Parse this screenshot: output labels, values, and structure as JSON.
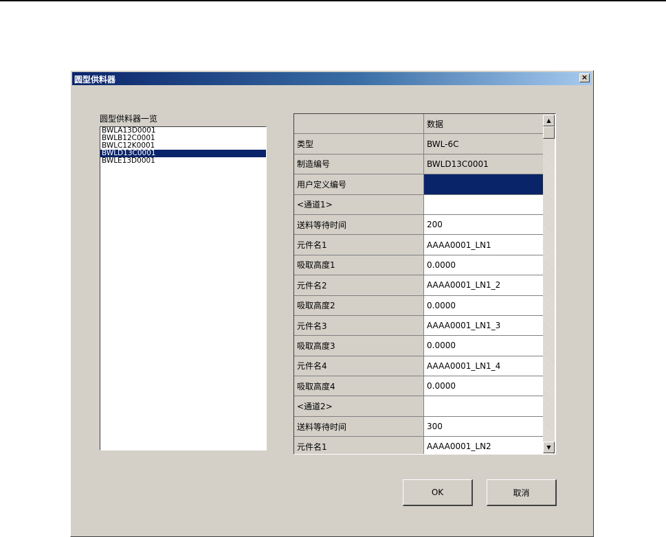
{
  "window": {
    "title": "圆型供料器",
    "close_label": "×"
  },
  "list": {
    "label": "圆型供料器一览",
    "items": [
      "BWLA13D0001",
      "BWLB12C0001",
      "BWLC12K0001",
      "BWLD13C0001",
      "BWLE13D0001"
    ],
    "selected_index": 3
  },
  "grid": {
    "header": [
      "",
      "数据"
    ],
    "rows": [
      {
        "label": "类型",
        "value": "BWL-6C"
      },
      {
        "label": "制造编号",
        "value": "BWLD13C0001"
      },
      {
        "label": "用户定义编号",
        "value": ""
      },
      {
        "label": "<通道1>",
        "value": ""
      },
      {
        "label": "送料等待时间",
        "value": "200"
      },
      {
        "label": "元件名1",
        "value": "AAAA0001_LN1"
      },
      {
        "label": "吸取高度1",
        "value": "0.0000"
      },
      {
        "label": "元件名2",
        "value": "AAAA0001_LN1_2"
      },
      {
        "label": "吸取高度2",
        "value": "0.0000"
      },
      {
        "label": "元件名3",
        "value": "AAAA0001_LN1_3"
      },
      {
        "label": "吸取高度3",
        "value": "0.0000"
      },
      {
        "label": "元件名4",
        "value": "AAAA0001_LN1_4"
      },
      {
        "label": "吸取高度4",
        "value": "0.0000"
      },
      {
        "label": "<通道2>",
        "value": ""
      },
      {
        "label": "送料等待时间",
        "value": "300"
      },
      {
        "label": "元件名1",
        "value": "AAAA0001_LN2"
      }
    ]
  },
  "scrollbar": {
    "up_icon": "▲",
    "down_icon": "▼"
  },
  "buttons": {
    "ok": "OK",
    "cancel": "取消"
  },
  "colors": {
    "selection": "#0a246a",
    "face": "#d4d0c8"
  }
}
